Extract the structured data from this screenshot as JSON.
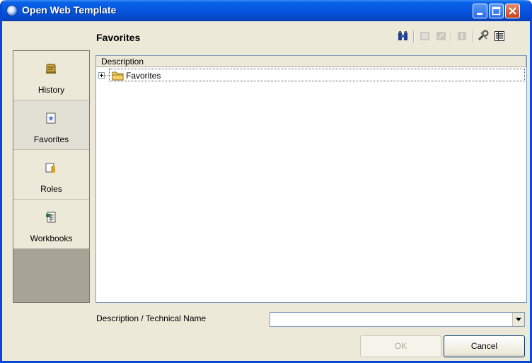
{
  "window": {
    "title": "Open Web Template"
  },
  "header": {
    "title": "Favorites",
    "toolbar": [
      {
        "name": "binoculars-icon",
        "enabled": true
      },
      {
        "name": "new-folder-icon",
        "enabled": false
      },
      {
        "name": "edit-icon",
        "enabled": false
      },
      {
        "name": "info-icon",
        "enabled": false
      },
      {
        "name": "tools-icon",
        "enabled": true
      },
      {
        "name": "details-view-icon",
        "enabled": true
      }
    ]
  },
  "sidebar": {
    "items": [
      {
        "label": "History",
        "icon": "scroll-icon",
        "selected": false
      },
      {
        "label": "Favorites",
        "icon": "star-document-icon",
        "selected": true
      },
      {
        "label": "Roles",
        "icon": "role-icon",
        "selected": false
      },
      {
        "label": "Workbooks",
        "icon": "workbook-icon",
        "selected": false
      }
    ]
  },
  "tree": {
    "column_header": "Description",
    "rows": [
      {
        "label": "Favorites",
        "icon": "folder-icon",
        "expander": "+"
      }
    ]
  },
  "search": {
    "label": "Description / Technical Name",
    "value": ""
  },
  "buttons": {
    "ok": "OK",
    "cancel": "Cancel"
  },
  "colors": {
    "title_bar": "#0554dd",
    "dialog_bg": "#ece9d8",
    "nav_empty": "#a8a495"
  }
}
